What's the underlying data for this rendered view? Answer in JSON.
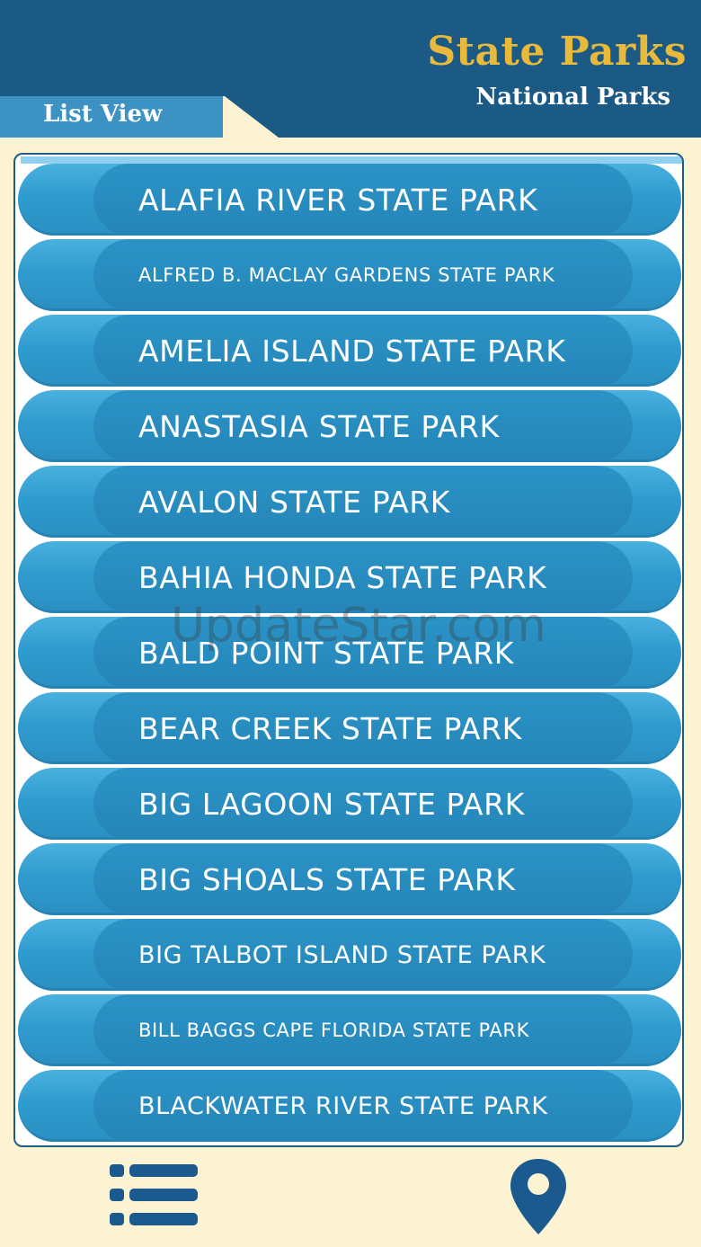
{
  "header": {
    "title": "State Parks",
    "subtitle": "National Parks",
    "tab_label": "List View"
  },
  "colors": {
    "header_bg": "#1b5a84",
    "title": "#e9b93c",
    "background": "#fbf3d1",
    "pill": "#2f9ccf",
    "icon": "#1a5a8e"
  },
  "parks": [
    {
      "name": "ALAFIA RIVER STATE PARK",
      "size": "big"
    },
    {
      "name": "ALFRED B. MACLAY GARDENS STATE PARK",
      "size": "small"
    },
    {
      "name": "AMELIA ISLAND STATE PARK",
      "size": "big"
    },
    {
      "name": "ANASTASIA STATE PARK",
      "size": "big"
    },
    {
      "name": "AVALON STATE PARK",
      "size": "big"
    },
    {
      "name": "BAHIA HONDA STATE PARK",
      "size": "big"
    },
    {
      "name": "BALD POINT STATE PARK",
      "size": "big"
    },
    {
      "name": "BEAR CREEK STATE PARK",
      "size": "big"
    },
    {
      "name": "BIG LAGOON STATE PARK",
      "size": "big"
    },
    {
      "name": "BIG SHOALS STATE PARK",
      "size": "big"
    },
    {
      "name": "BIG TALBOT ISLAND STATE PARK",
      "size": "mid"
    },
    {
      "name": "BILL BAGGS CAPE FLORIDA STATE PARK",
      "size": "small"
    },
    {
      "name": "BLACKWATER RIVER STATE PARK",
      "size": "mid"
    }
  ],
  "watermark": "UpdateStar.com",
  "bottom_bar": {
    "list_icon": "list-icon",
    "map_icon": "map-pin-icon"
  }
}
